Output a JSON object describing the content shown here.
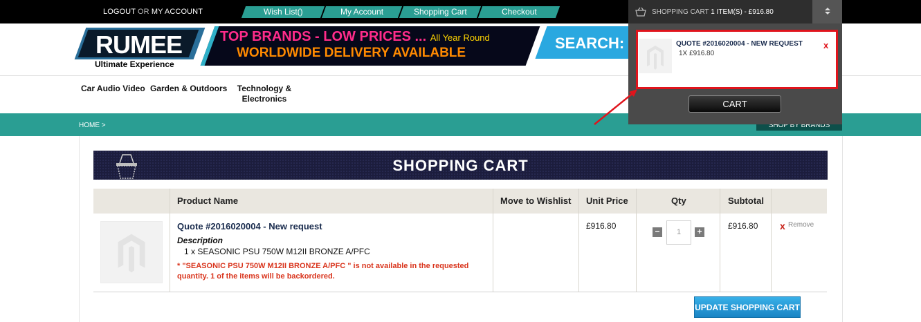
{
  "topbar": {
    "logout": "LOGOUT",
    "or": "OR",
    "my_account": "MY ACCOUNT",
    "tabs": [
      "Wish List()",
      "My Account",
      "Shopping Cart",
      "Checkout"
    ]
  },
  "header": {
    "logo": "RUMEE",
    "tagline": "Ultimate Experience",
    "banner_line1": "TOP BRANDS - LOW PRICES ...",
    "banner_line1_small": "All Year Round",
    "banner_line2": "WORLDWIDE DELIVERY AVAILABLE",
    "search_label": "SEARCH:"
  },
  "nav": [
    "Car Audio Video",
    "Garden & Outdoors",
    "Technology & Electronics"
  ],
  "breadcrumb": "HOME   >",
  "shop_by_brands": "SHOP BY BRANDS",
  "cart": {
    "title": "SHOPPING CART",
    "columns": [
      "Product Name",
      "Move to Wishlist",
      "Unit Price",
      "Qty",
      "Subtotal"
    ],
    "item": {
      "name": "Quote #2016020004 - New request",
      "description_label": "Description",
      "description": "1 x SEASONIC PSU 750W M12II BRONZE A/PFC",
      "warning": "* \"SEASONIC PSU 750W M12II BRONZE A/PFC \" is not available in the requested quantity. 1 of the items will be backordered.",
      "unit_price": "£916.80",
      "qty": "1",
      "subtotal": "£916.80",
      "remove": "Remove"
    },
    "update_button": "UPDATE SHOPPING CART"
  },
  "minicart": {
    "header_label": "SHOPPING CART",
    "header_summary": "1 ITEM(S) - £916.80",
    "item_name": "QUOTE #2016020004 - NEW REQUEST",
    "item_qty": "1X £916.80",
    "remove": "x",
    "cart_button": "CART"
  },
  "colors": {
    "teal": "#2a9e93",
    "highlight_red": "#e0141c",
    "banner_navy": "#1c1d3d",
    "button_blue": "#1a84c4"
  }
}
